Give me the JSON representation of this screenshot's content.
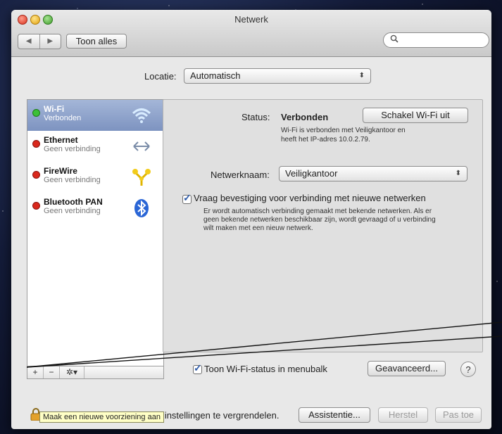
{
  "window": {
    "title": "Netwerk"
  },
  "toolbar": {
    "back_glyph": "◀",
    "forward_glyph": "▶",
    "show_all_label": "Toon alles",
    "search_placeholder": "",
    "search_icon": "search-icon"
  },
  "location": {
    "label": "Locatie:",
    "value": "Automatisch"
  },
  "services": [
    {
      "name": "Wi-Fi",
      "status": "Verbonden",
      "status_color": "#35b52e",
      "icon": "wifi-icon"
    },
    {
      "name": "Ethernet",
      "status": "Geen verbinding",
      "status_color": "#d22a1d",
      "icon": "ethernet-arrows-icon"
    },
    {
      "name": "FireWire",
      "status": "Geen verbinding",
      "status_color": "#d22a1d",
      "icon": "firewire-icon"
    },
    {
      "name": "Bluetooth PAN",
      "status": "Geen verbinding",
      "status_color": "#d22a1d",
      "icon": "bluetooth-icon"
    }
  ],
  "sidebar_tools": {
    "add": "+",
    "remove": "−",
    "gear": "✲▾"
  },
  "detail": {
    "status_label": "Status:",
    "status_value": "Verbonden",
    "turn_off_button": "Schakel Wi-Fi uit",
    "status_description_1": "Wi-Fi is verbonden met Veiligkantoor en",
    "status_description_2": "heeft het IP-adres 10.0.2.79.",
    "network_name_label": "Netwerknaam:",
    "network_name_value": "Veiligkantoor",
    "ask_join_checked": true,
    "ask_join_label": "Vraag bevestiging voor verbinding met nieuwe netwerken",
    "ask_join_desc_1": "Er wordt automatisch verbinding gemaakt met bekende netwerken. Als er",
    "ask_join_desc_2": "geen bekende netwerken beschikbaar zijn, wordt gevraagd of u verbinding",
    "ask_join_desc_3": "wilt maken met een nieuw netwerk.",
    "show_status_checked": true,
    "show_status_label": "Toon Wi-Fi-status in menubalk",
    "advanced_button": "Geavanceerd...",
    "help_button": "?"
  },
  "footer": {
    "lock_text": "Klik op het hangslot om de instellingen te vergrendelen.",
    "assist_button": "Assistentie...",
    "revert_button": "Herstel",
    "apply_button": "Pas toe"
  },
  "tooltip": {
    "text": "Maak een nieuwe voorziening aan"
  },
  "colors": {
    "selection": "#8ea2cb",
    "checkmark": "#2d5aa8"
  }
}
